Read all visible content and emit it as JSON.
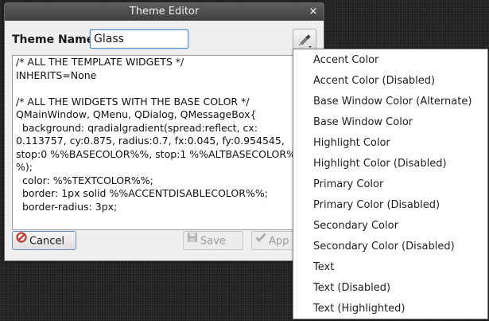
{
  "window": {
    "title": "Theme Editor",
    "close_glyph": "×"
  },
  "theme_name": {
    "label": "Theme Name:",
    "value": "Glass"
  },
  "editor_lines": [
    "/* ALL THE TEMPLATE WIDGETS */",
    "INHERITS=None",
    "",
    "/* ALL THE WIDGETS WITH THE BASE COLOR */",
    "QMainWindow, QMenu, QDialog, QMessageBox{",
    "  background: qradialgradient(spread:reflect, cx:",
    "0.113757, cy:0.875, radius:0.7, fx:0.045, fy:0.954545,",
    "stop:0 %%BASECOLOR%%, stop:1 %%ALTBASECOLOR%",
    "%);",
    "  color: %%TEXTCOLOR%%;",
    "  border: 1px solid %%ACCENTDISABLECOLOR%%;",
    "  border-radius: 3px;"
  ],
  "buttons": {
    "cancel": "Cancel",
    "save": "Save",
    "apply": "App"
  },
  "icons": {
    "cancel": "cancel-icon",
    "save": "save-icon",
    "apply": "checkmark-icon",
    "menu": "color-picker-icon",
    "close": "close-icon"
  },
  "colors": {
    "titlebar": "#4a4a4a",
    "focus_border": "#4f8fd8",
    "cancel_icon": "#c0392b"
  },
  "color_menu": [
    "Accent Color",
    "Accent Color (Disabled)",
    "Base Window Color (Alternate)",
    "Base Window Color",
    "Highlight Color",
    "Highlight Color (Disabled)",
    "Primary Color",
    "Primary Color (Disabled)",
    "Secondary Color",
    "Secondary Color (Disabled)",
    "Text",
    "Text (Disabled)",
    "Text (Highlighted)"
  ]
}
